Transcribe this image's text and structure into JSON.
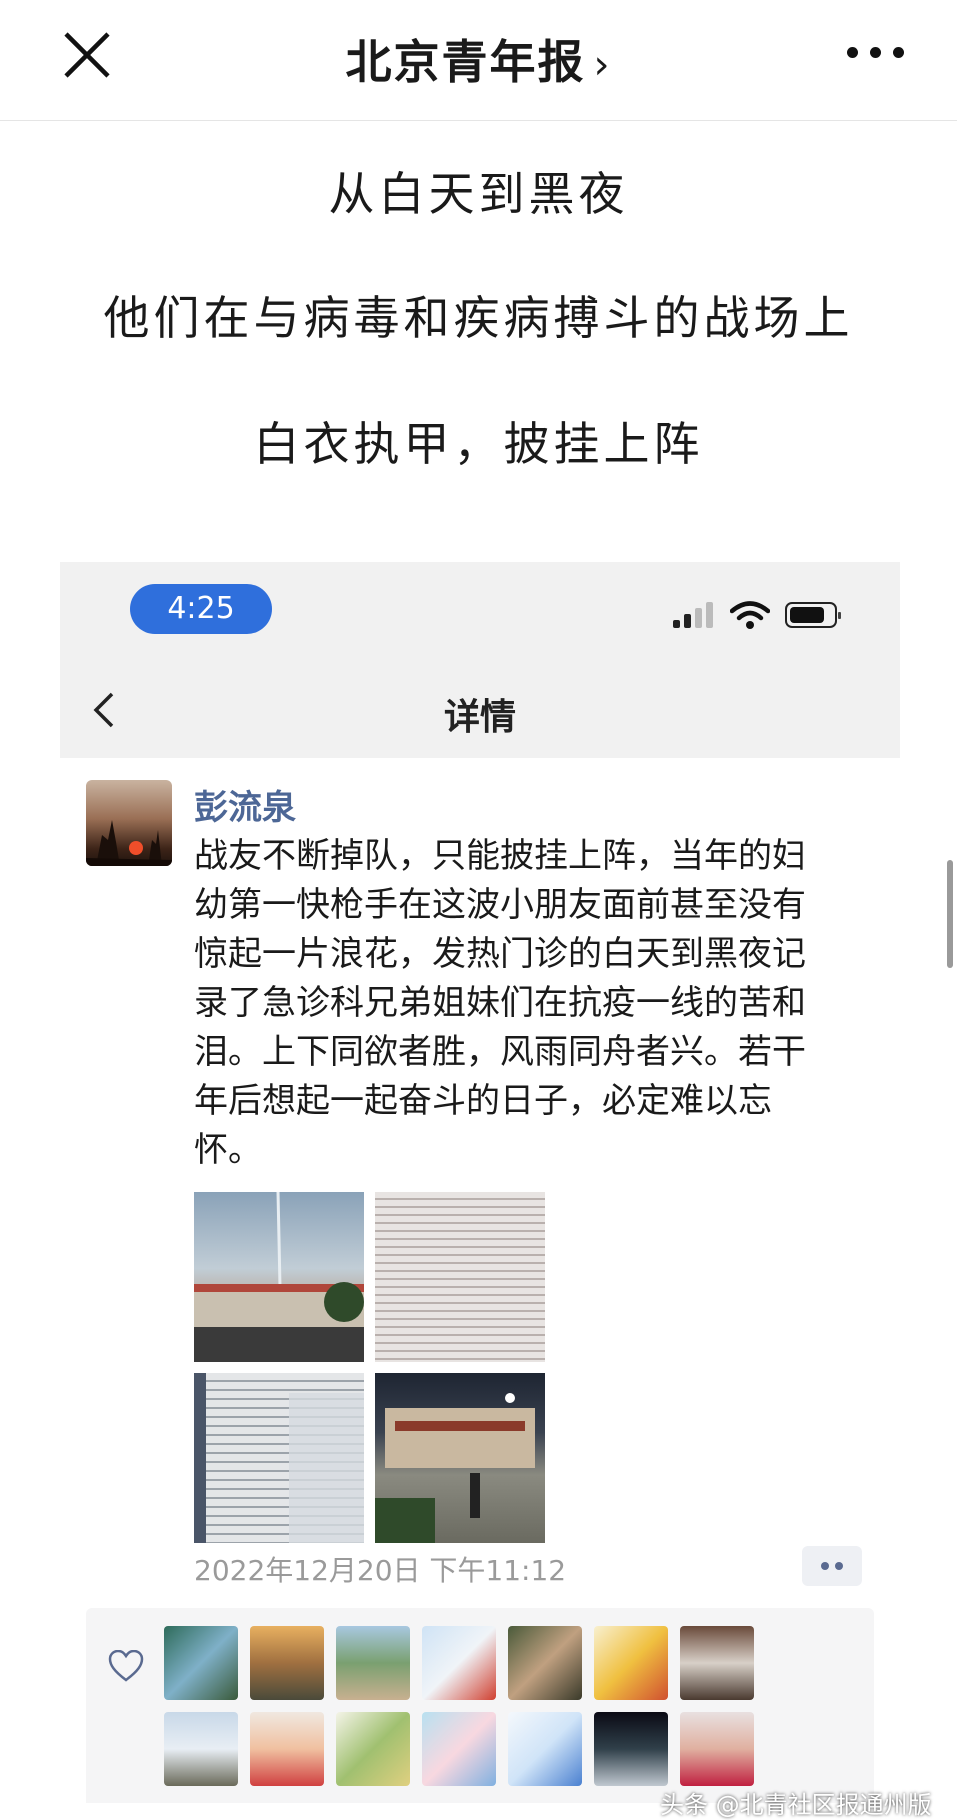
{
  "nav": {
    "title": "北京青年报",
    "chevron": "›",
    "close_icon": "close-icon",
    "more_icon": "more-icon"
  },
  "captions": [
    "从白天到黑夜",
    "他们在与病毒和疾病搏斗的战场上",
    "白衣执甲，披挂上阵"
  ],
  "screenshot": {
    "status_bar": {
      "time": "4:25"
    },
    "page_title": "详情",
    "post": {
      "author": "彭流泉",
      "text_lines": [
        "战友不断掉队，只能披挂上阵，当年的妇",
        "幼第一快枪手在这波小朋友面前甚至没有",
        "惊起一片浪花，发热门诊的白天到黑夜记",
        "录了急诊科兄弟姐妹们在抗疫一线的苦和",
        "泪。上下同欲者胜，风雨同舟者兴。若干",
        "年后想起一起奋斗的日子，必定难以忘",
        "怀。"
      ],
      "timestamp": "2022年12月20日 下午11:12"
    }
  },
  "watermark": "头条 @北青社区报通州版"
}
